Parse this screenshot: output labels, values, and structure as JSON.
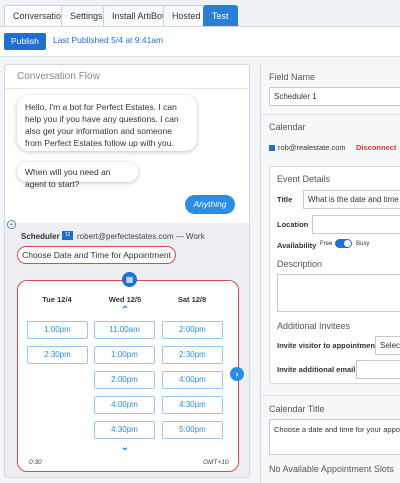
{
  "tabs": [
    {
      "label": "Conversation",
      "state": "active"
    },
    {
      "label": "Settings",
      "state": "normal"
    },
    {
      "label": "Install ArtiBot",
      "state": "normal"
    },
    {
      "label": "Hosted",
      "state": "normal"
    },
    {
      "label": "Test",
      "state": "primary"
    }
  ],
  "toolbar": {
    "publish_label": "Publish",
    "last_published": "Last Published 5/4 at 9:41am"
  },
  "flow": {
    "title": "Conversation Flow",
    "bot_message": "Hello, I'm a bot for Perfect Estates. I can help you if you have any questions. I can also get your information and someone from Perfect Estates follow up with you.",
    "question": "When will you need an agent to start?",
    "user_reply": "Anything",
    "scheduler_label": "Scheduler",
    "calendar_icon_text": "12",
    "scheduler_account": "robert@perfectestates.com — Work",
    "choose_prompt": "Choose Date and Time for Appointment"
  },
  "picker": {
    "days": [
      {
        "label": "Tue 12/4",
        "slots": [
          "1:00pm",
          "2:30pm"
        ]
      },
      {
        "label": "Wed 12/5",
        "slots": [
          "11:00am",
          "1:00pm",
          "2:00pm",
          "4:00pm",
          "4:30pm"
        ]
      },
      {
        "label": "Sat 12/8",
        "slots": [
          "2:00pm",
          "2:30pm",
          "4:00pm",
          "4:30pm",
          "5:00pm"
        ]
      }
    ],
    "duration": "0:30",
    "timezone": "GMT+10"
  },
  "fields": {
    "field_name_label": "Field Name",
    "field_name_value": "Scheduler 1",
    "calendar_label": "Calendar",
    "calendar_email": "rob@realestate.com",
    "disconnect_label": "Disconnect",
    "event_details_label": "Event Details",
    "title_label": "Title",
    "title_value": "What is the date and time of yo",
    "location_label": "Location",
    "availability_label": "Availability",
    "free_label": "Free",
    "busy_label": "Busy",
    "description_label": "Description",
    "additional_invitees_label": "Additional Invitees",
    "invite_visitor_label": "Invite visitor to appointment",
    "invite_visitor_value": "Select",
    "invite_email_label": "Invite additional email",
    "calendar_title_label": "Calendar Title",
    "calendar_title_value": "Choose a date and time for your appoint",
    "no_slots_label": "No Available Appointment Slots"
  },
  "colors": {
    "accent": "#1f6fd0",
    "bubble_blue": "#2a8de8",
    "danger": "#d94b4b"
  }
}
